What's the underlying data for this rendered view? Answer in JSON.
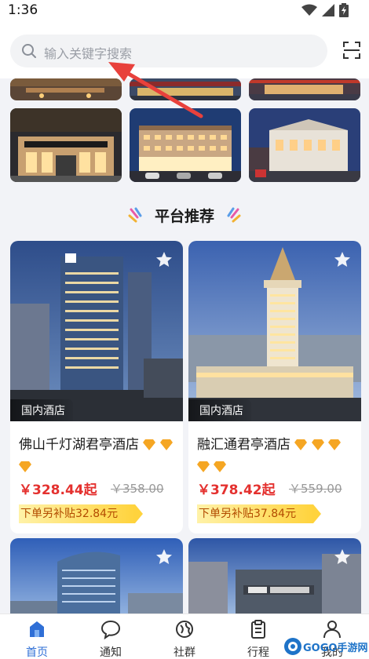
{
  "status_bar": {
    "time": "1:36"
  },
  "search": {
    "placeholder": "输入关键字搜索"
  },
  "section": {
    "title": "平台推荐"
  },
  "hotels": [
    {
      "name": "佛山千灯湖君亭酒店",
      "tag": "国内酒店",
      "diamonds": 3,
      "price": "￥328.44起",
      "original_price": "￥358.00",
      "subsidy": "下单另补贴32.84元"
    },
    {
      "name": "融汇通君亭酒店",
      "tag": "国内酒店",
      "diamonds": 5,
      "price": "￥378.42起",
      "original_price": "￥559.00",
      "subsidy": "下单另补贴37.84元"
    }
  ],
  "tabbar": {
    "items": [
      {
        "label": "首页",
        "icon": "home-icon",
        "active": true
      },
      {
        "label": "通知",
        "icon": "chat-bubble-icon",
        "active": false
      },
      {
        "label": "社群",
        "icon": "community-icon",
        "active": false
      },
      {
        "label": "行程",
        "icon": "clipboard-icon",
        "active": false
      },
      {
        "label": "我的",
        "icon": "user-icon",
        "active": false
      }
    ]
  },
  "watermark": {
    "text": "GOGO手游网"
  },
  "colors": {
    "accent": "#2f6fd6",
    "price": "#e4312f",
    "diamond": "#f5a623"
  }
}
